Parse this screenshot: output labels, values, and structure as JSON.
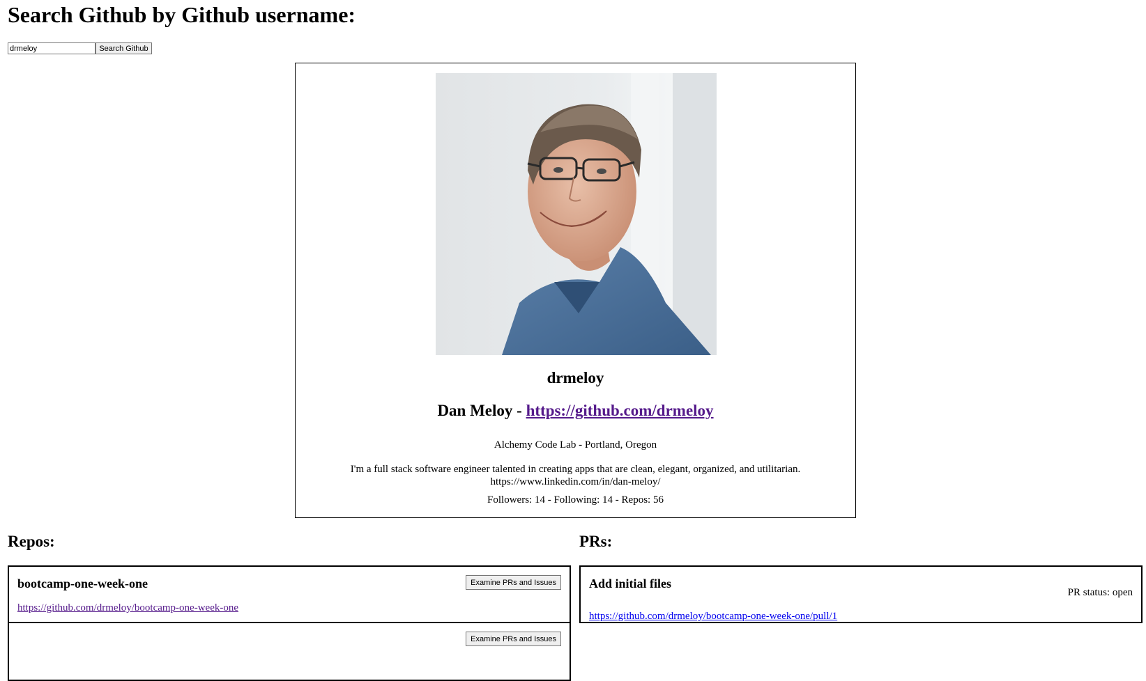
{
  "header": {
    "title": "Search Github by Github username:"
  },
  "search": {
    "value": "drmeloy",
    "button_label": "Search Github"
  },
  "profile": {
    "login": "drmeloy",
    "name": "Dan Meloy",
    "separator": " - ",
    "url": "https://github.com/drmeloy",
    "company_location": "Alchemy Code Lab - Portland, Oregon",
    "bio_line1": "I'm a full stack software engineer talented in creating apps that are clean, elegant, organized, and utilitarian.",
    "bio_line2": "https://www.linkedin.com/in/dan-meloy/",
    "stats": "Followers: 14 - Following: 14 - Repos: 56"
  },
  "repos": {
    "heading": "Repos:",
    "items": [
      {
        "name": "bootcamp-one-week-one",
        "url": "https://github.com/drmeloy/bootcamp-one-week-one",
        "button_label": "Examine PRs and Issues"
      },
      {
        "name": "",
        "url": "",
        "button_label": "Examine PRs and Issues"
      }
    ]
  },
  "prs": {
    "heading": "PRs:",
    "items": [
      {
        "title": "Add initial files",
        "status": "PR status: open",
        "url": "https://github.com/drmeloy/bootcamp-one-week-one/pull/1"
      }
    ]
  },
  "colors": {
    "visited_link": "#551a8b",
    "link": "#0000ee",
    "border": "#000000",
    "button_bg": "#efefef"
  }
}
